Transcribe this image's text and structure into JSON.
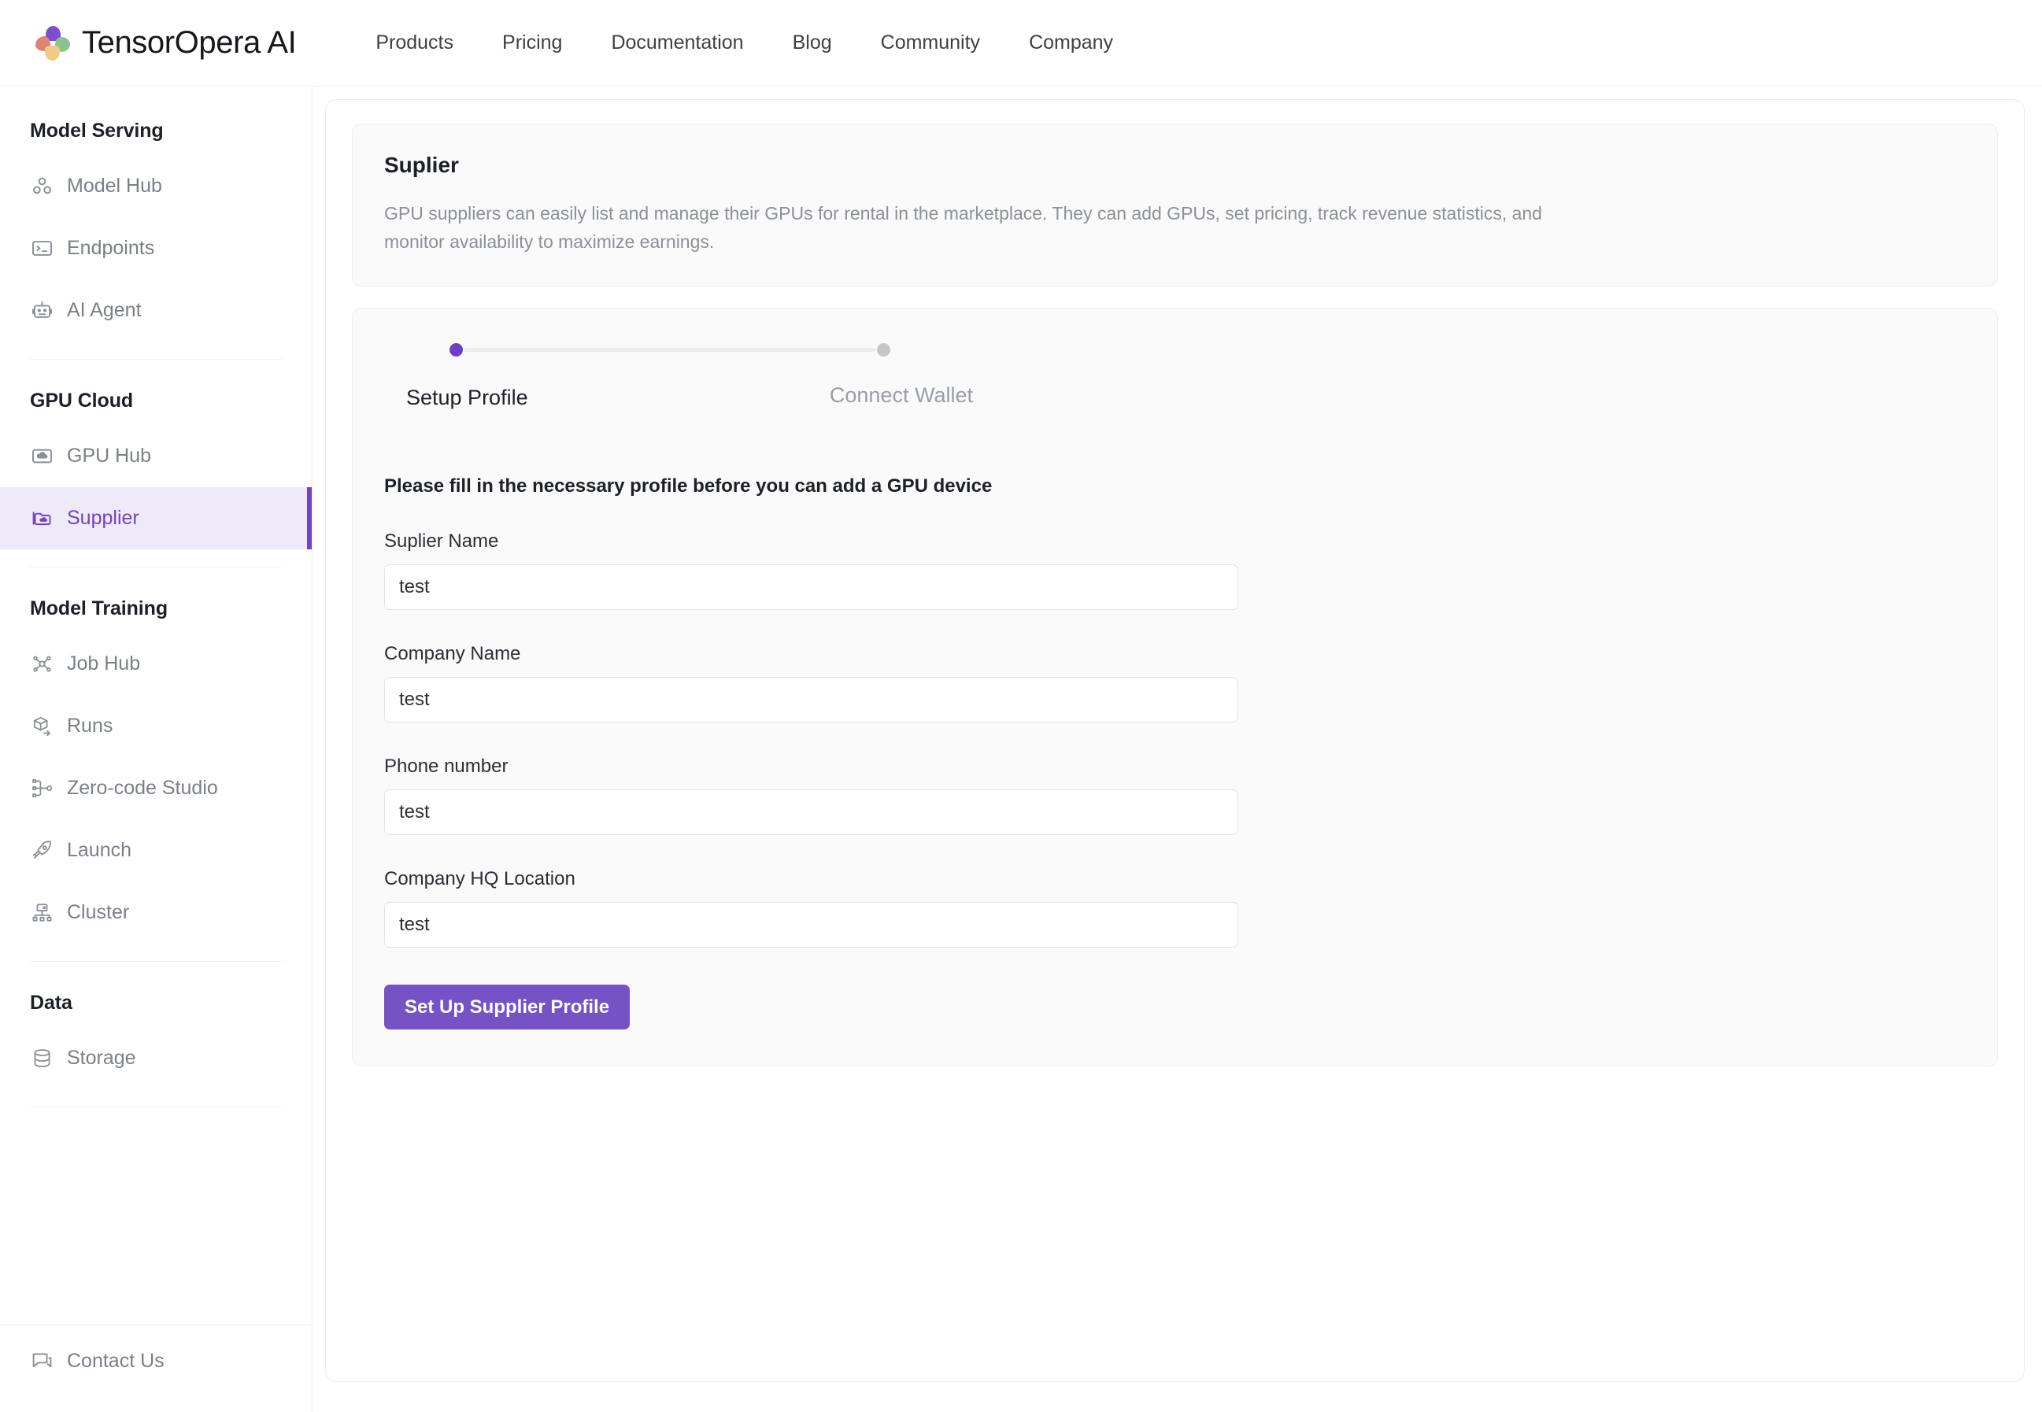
{
  "header": {
    "brand": "TensorOpera AI",
    "nav": [
      {
        "label": "Products"
      },
      {
        "label": "Pricing"
      },
      {
        "label": "Documentation"
      },
      {
        "label": "Blog"
      },
      {
        "label": "Community"
      },
      {
        "label": "Company"
      }
    ]
  },
  "sidebar": {
    "groups": [
      {
        "title": "Model Serving",
        "items": [
          {
            "label": "Model Hub",
            "icon": "boxes-icon",
            "active": false
          },
          {
            "label": "Endpoints",
            "icon": "terminal-icon",
            "active": false
          },
          {
            "label": "AI Agent",
            "icon": "robot-icon",
            "active": false
          }
        ]
      },
      {
        "title": "GPU Cloud",
        "items": [
          {
            "label": "GPU Hub",
            "icon": "cloud-box-icon",
            "active": false
          },
          {
            "label": "Supplier",
            "icon": "folders-cloud-icon",
            "active": true
          }
        ]
      },
      {
        "title": "Model Training",
        "items": [
          {
            "label": "Job Hub",
            "icon": "network-nodes-icon",
            "active": false
          },
          {
            "label": "Runs",
            "icon": "cube-arrow-icon",
            "active": false
          },
          {
            "label": "Zero-code Studio",
            "icon": "flow-branch-icon",
            "active": false
          },
          {
            "label": "Launch",
            "icon": "rocket-icon",
            "active": false
          }
        ]
      }
    ],
    "cluster_item": {
      "label": "Cluster",
      "icon": "cluster-icon"
    },
    "data_group": {
      "title": "Data",
      "items": [
        {
          "label": "Storage",
          "icon": "database-icon",
          "active": false
        }
      ]
    },
    "footer": {
      "label": "Contact Us",
      "icon": "chat-icon"
    }
  },
  "main": {
    "intro": {
      "title": "Suplier",
      "description": "GPU suppliers can easily list and manage their GPUs for rental in the marketplace. They can add GPUs, set pricing, track revenue statistics, and monitor availability to maximize earnings."
    },
    "stepper": {
      "steps": [
        {
          "label": "Setup Profile",
          "state": "active"
        },
        {
          "label": "Connect Wallet",
          "state": "inactive"
        }
      ]
    },
    "form": {
      "hint": "Please fill in the necessary profile before you can add a GPU device",
      "fields": [
        {
          "label": "Suplier Name",
          "value": "test",
          "placeholder": ""
        },
        {
          "label": "Company Name",
          "value": "test",
          "placeholder": ""
        },
        {
          "label": "Phone number",
          "value": "test",
          "placeholder": ""
        },
        {
          "label": "Company HQ Location",
          "value": "test",
          "placeholder": ""
        }
      ],
      "submit_label": "Set Up Supplier Profile"
    }
  },
  "colors": {
    "accent": "#7552c6",
    "accent_active_bg": "#efeaf8",
    "accent_text": "#7144c4",
    "card_bg": "#fafafa"
  }
}
